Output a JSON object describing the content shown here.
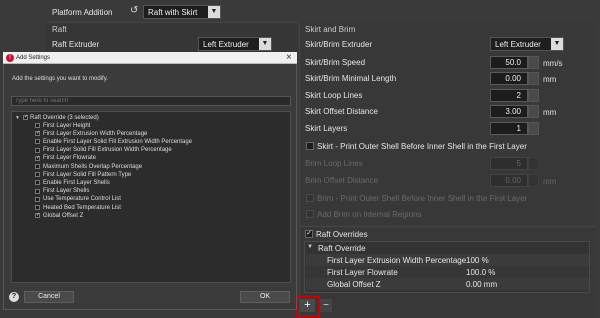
{
  "top": {
    "platform_addition_label": "Platform Addition",
    "platform_addition_value": "Raft with Skirt",
    "raft_section_label": "Raft",
    "raft_extruder_label": "Raft Extruder",
    "raft_extruder_value": "Left Extruder"
  },
  "skirt": {
    "section_title": "Skirt and Brim",
    "extruder_label": "Skirt/Brim Extruder",
    "extruder_value": "Left Extruder",
    "speed_label": "Skirt/Brim Speed",
    "speed_value": "50.0",
    "speed_unit": "mm/s",
    "min_length_label": "Skirt/Brim Minimal Length",
    "min_length_value": "0.00",
    "min_length_unit": "mm",
    "loop_lines_label": "Skirt Loop Lines",
    "loop_lines_value": "2",
    "offset_label": "Skirt Offset Distance",
    "offset_value": "3.00",
    "offset_unit": "mm",
    "layers_label": "Skirt Layers",
    "layers_value": "1",
    "print_outer_label": "Skirt - Print Outer Shell Before Inner Shell in the First Layer",
    "brim_loop_label": "Brim Loop Lines",
    "brim_loop_value": "5",
    "brim_offset_label": "Brim Offset Distance",
    "brim_offset_value": "0.00",
    "brim_offset_unit": "mm",
    "brim_print_outer_label": "Brim - Print Outer Shell Before Inner Shell in the First Layer",
    "add_brim_label": "Add Brim on Internal Regions"
  },
  "raft_overrides": {
    "title": "Raft Overrides",
    "group_label": "Raft Override",
    "rows": [
      {
        "name": "First Layer Extrusion Width Percentage",
        "value": "100 %"
      },
      {
        "name": "First Layer Flowrate",
        "value": "100.0 %"
      },
      {
        "name": "Global Offset Z",
        "value": "0.00 mm"
      }
    ],
    "add_label": "+",
    "remove_label": "−"
  },
  "dialog": {
    "title": "Add Settings",
    "close_label": "×",
    "instruction": "Add the settings you want to modify.",
    "search_placeholder": "Type here to search",
    "tree_root": "Raft Override (3 selected)",
    "items": [
      {
        "label": "First Layer Height",
        "checked": false
      },
      {
        "label": "First Layer Extrusion Width Percentage",
        "checked": true
      },
      {
        "label": "Enable First Layer Solid Fill Extrusion Width Percentage",
        "checked": false
      },
      {
        "label": "First Layer Solid Fill Extrusion Width Percentage",
        "checked": false
      },
      {
        "label": "First Layer Flowrate",
        "checked": true
      },
      {
        "label": "Maximum Shells Overlap Percentage",
        "checked": false
      },
      {
        "label": "First Layer Solid Fill Pattern Type",
        "checked": false
      },
      {
        "label": "Enable First Layer Shells",
        "checked": false
      },
      {
        "label": "First Layer Shells",
        "checked": false
      },
      {
        "label": "Use Temperature Control List",
        "checked": false
      },
      {
        "label": "Heated Bed Temperature List",
        "checked": false
      },
      {
        "label": "Global Offset Z",
        "checked": true
      }
    ],
    "help_label": "?",
    "cancel_label": "Cancel",
    "ok_label": "OK"
  },
  "colors": {
    "highlight": "#cc0000",
    "panel_bg": "#3a3a3a",
    "field_bg": "#1c1c1c"
  }
}
